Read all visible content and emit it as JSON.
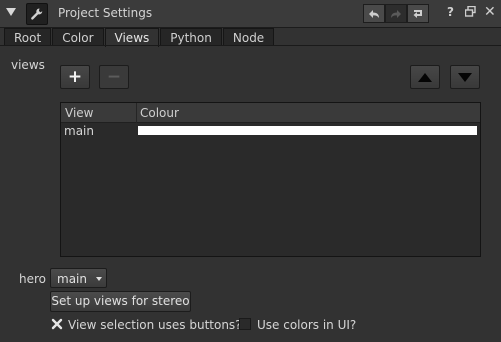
{
  "window": {
    "title": "Project Settings"
  },
  "title_icons": {
    "collapse": "triangle-down-icon",
    "settings": "wrench-icon",
    "undo": "undo-icon",
    "redo": "redo-icon",
    "revert": "revert-icon",
    "help": "?",
    "float": "float-window-icon",
    "close": "✕"
  },
  "tabs": [
    {
      "label": "Root",
      "active": false
    },
    {
      "label": "Color",
      "active": false
    },
    {
      "label": "Views",
      "active": true
    },
    {
      "label": "Python",
      "active": false
    },
    {
      "label": "Node",
      "active": false
    }
  ],
  "views": {
    "label": "views",
    "add_label": "+",
    "remove_label": "−",
    "table": {
      "headers": [
        "View",
        "Colour"
      ],
      "rows": [
        {
          "name": "main",
          "colour": "#ffffff"
        }
      ]
    }
  },
  "hero": {
    "label": "hero",
    "value": "main"
  },
  "stereo_button": "Set up views for stereo",
  "checkboxes": {
    "view_selection": {
      "label": "View selection uses buttons?",
      "checked": true
    },
    "use_colors": {
      "label": "Use colors in UI?",
      "checked": false
    }
  }
}
